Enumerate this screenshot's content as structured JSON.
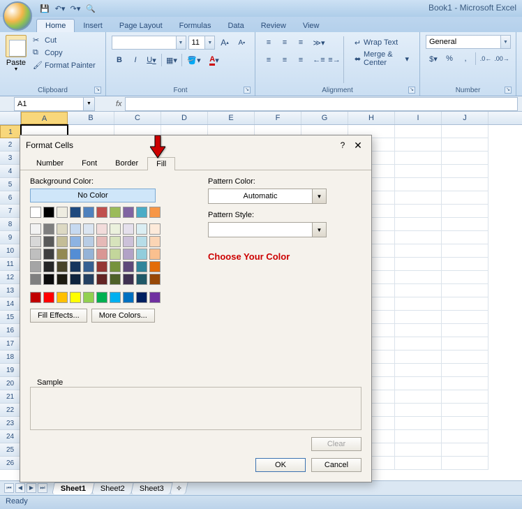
{
  "app": {
    "title": "Book1 - Microsoft Excel"
  },
  "qat": {
    "save": "save-icon",
    "undo": "undo-icon",
    "redo": "redo-icon",
    "home": "home-icon"
  },
  "tabs": [
    "Home",
    "Insert",
    "Page Layout",
    "Formulas",
    "Data",
    "Review",
    "View"
  ],
  "active_tab": "Home",
  "ribbon": {
    "clipboard": {
      "label": "Clipboard",
      "paste": "Paste",
      "cut": "Cut",
      "copy": "Copy",
      "fp": "Format Painter"
    },
    "font": {
      "label": "Font",
      "name": "",
      "size": "11",
      "bold": "B",
      "italic": "I",
      "underline": "U"
    },
    "alignment": {
      "label": "Alignment",
      "wrap": "Wrap Text",
      "merge": "Merge & Center"
    },
    "number": {
      "label": "Number",
      "format": "General"
    }
  },
  "namebox": "A1",
  "columns": [
    "A",
    "B",
    "C",
    "D",
    "E",
    "F",
    "G",
    "H",
    "I",
    "J"
  ],
  "rows": [
    1,
    2,
    3,
    4,
    5,
    6,
    7,
    8,
    9,
    10,
    11,
    12,
    13,
    14,
    15,
    16,
    17,
    18,
    19,
    20,
    21,
    22,
    23,
    24,
    25,
    26
  ],
  "sheets": [
    "Sheet1",
    "Sheet2",
    "Sheet3"
  ],
  "active_sheet": "Sheet1",
  "status": "Ready",
  "dialog": {
    "title": "Format Cells",
    "tabs": [
      "Number",
      "Font",
      "Border",
      "Fill"
    ],
    "active_tab": "Fill",
    "bg_label": "Background Color:",
    "no_color": "No Color",
    "fill_effects": "Fill Effects...",
    "more_colors": "More Colors...",
    "pattern_color_label": "Pattern Color:",
    "pattern_color_value": "Automatic",
    "pattern_style_label": "Pattern Style:",
    "pattern_style_value": "",
    "annotation": "Choose Your Color",
    "sample": "Sample",
    "clear": "Clear",
    "ok": "OK",
    "cancel": "Cancel"
  },
  "colors": {
    "row1": [
      "#ffffff",
      "#000000",
      "#eeece1",
      "#1f497d",
      "#4f81bd",
      "#c0504d",
      "#9bbb59",
      "#8064a2",
      "#4bacc6",
      "#f79646"
    ],
    "shades": [
      [
        "#f2f2f2",
        "#7f7f7f",
        "#ddd9c3",
        "#c6d9f0",
        "#dbe5f1",
        "#f2dcdb",
        "#ebf1dd",
        "#e5e0ec",
        "#dbeef3",
        "#fdeada"
      ],
      [
        "#d8d8d8",
        "#595959",
        "#c4bd97",
        "#8db3e2",
        "#b8cce4",
        "#e5b9b7",
        "#d7e3bc",
        "#ccc1d9",
        "#b7dde8",
        "#fbd5b5"
      ],
      [
        "#bfbfbf",
        "#3f3f3f",
        "#938953",
        "#548dd4",
        "#95b3d7",
        "#d99694",
        "#c3d69b",
        "#b2a2c7",
        "#92cddc",
        "#fac08f"
      ],
      [
        "#a5a5a5",
        "#262626",
        "#494429",
        "#17365d",
        "#366092",
        "#953734",
        "#76923c",
        "#5f497a",
        "#31859b",
        "#e36c09"
      ],
      [
        "#7f7f7f",
        "#0c0c0c",
        "#1d1b10",
        "#0f243e",
        "#244061",
        "#632423",
        "#4f6128",
        "#3f3151",
        "#205867",
        "#974806"
      ]
    ],
    "standard": [
      "#c00000",
      "#ff0000",
      "#ffc000",
      "#ffff00",
      "#92d050",
      "#00b050",
      "#00b0f0",
      "#0070c0",
      "#002060",
      "#7030a0"
    ]
  }
}
